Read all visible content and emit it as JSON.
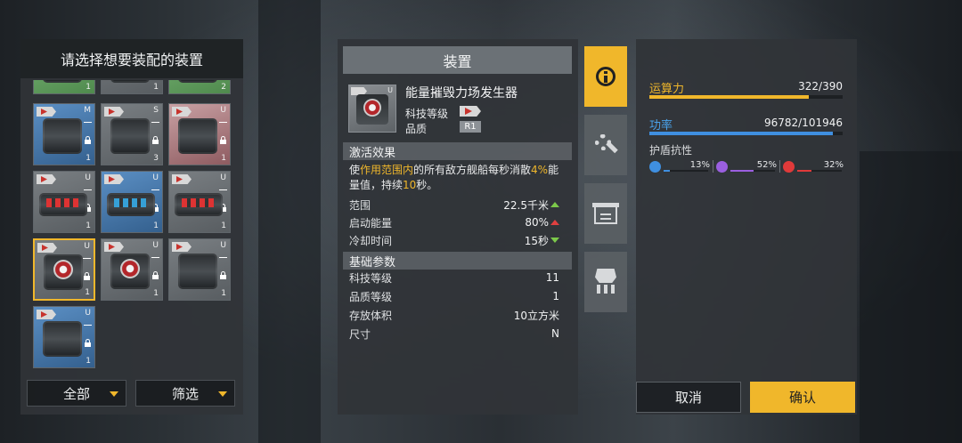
{
  "left_panel": {
    "title": "请选择想要装配的装置",
    "items": [
      {
        "grade": "",
        "count": "1",
        "color": "green"
      },
      {
        "grade": "",
        "count": "1",
        "color": "gray"
      },
      {
        "grade": "",
        "count": "2",
        "color": "green"
      },
      {
        "grade": "M",
        "count": "1",
        "color": "blue"
      },
      {
        "grade": "S",
        "count": "3",
        "color": "gray"
      },
      {
        "grade": "U",
        "count": "1",
        "color": "pink"
      },
      {
        "grade": "U",
        "count": "1",
        "color": "gray"
      },
      {
        "grade": "U",
        "count": "1",
        "color": "blue"
      },
      {
        "grade": "U",
        "count": "1",
        "color": "gray"
      },
      {
        "grade": "U",
        "count": "1",
        "color": "gray"
      },
      {
        "grade": "U",
        "count": "1",
        "color": "gray"
      },
      {
        "grade": "U",
        "count": "1",
        "color": "gray"
      },
      {
        "grade": "U",
        "count": "1",
        "color": "blue"
      }
    ],
    "filter_all_label": "全部",
    "filter_label": "筛选"
  },
  "center_panel": {
    "title": "装置",
    "device_name": "能量摧毁力场发生器",
    "device_grade": "U",
    "tech_level_label": "科技等级",
    "quality_label": "品质",
    "quality_value": "R1",
    "activation_header": "激活效果",
    "effect_parts": {
      "p1": "使",
      "p2": "作用范围内",
      "p3": "的所有敌方舰船每秒消散",
      "p4": "4%",
      "p5": "能量值，持续",
      "p6": "10",
      "p7": "秒。"
    },
    "effect_rows": [
      {
        "label": "范围",
        "value": "22.5千米",
        "trend": "up-green"
      },
      {
        "label": "启动能量",
        "value": "80%",
        "trend": "up-red"
      },
      {
        "label": "冷却时间",
        "value": "15秒",
        "trend": "down-green"
      }
    ],
    "basic_header": "基础参数",
    "basic_rows": [
      {
        "label": "科技等级",
        "value": "11"
      },
      {
        "label": "品质等级",
        "value": "1"
      },
      {
        "label": "存放体积",
        "value": "10立方米"
      },
      {
        "label": "尺寸",
        "value": "N"
      }
    ]
  },
  "side_tabs": [
    {
      "name": "info-tab",
      "icon": "info-icon",
      "active": true
    },
    {
      "name": "modules-tab",
      "icon": "gear-wrench-icon",
      "active": false
    },
    {
      "name": "list-tab",
      "icon": "list-icon",
      "active": false
    },
    {
      "name": "ship-tab",
      "icon": "ship-icon",
      "active": false
    }
  ],
  "right_panel": {
    "computing_label": "运算力",
    "computing_value": "322/390",
    "computing_fraction": 0.826,
    "power_label": "功率",
    "power_value": "96782/101946",
    "power_fraction": 0.949,
    "shield_label": "护盾抗性",
    "resistances": [
      {
        "pct": "13%",
        "fraction": 0.13,
        "color": "#3f8fe0",
        "icon": "lightning-icon"
      },
      {
        "pct": "52%",
        "fraction": 0.52,
        "color": "#9b5fe0",
        "icon": "energy-icon"
      },
      {
        "pct": "32%",
        "fraction": 0.32,
        "color": "#e03a3a",
        "icon": "fire-icon"
      }
    ],
    "cancel_label": "取消",
    "confirm_label": "确认"
  },
  "colors": {
    "accent": "#f0b72b",
    "computing_bar": "#f0b72b",
    "power_bar": "#3f8fe0",
    "computing_label": "#f0b72b",
    "power_label": "#4aa2ea"
  }
}
